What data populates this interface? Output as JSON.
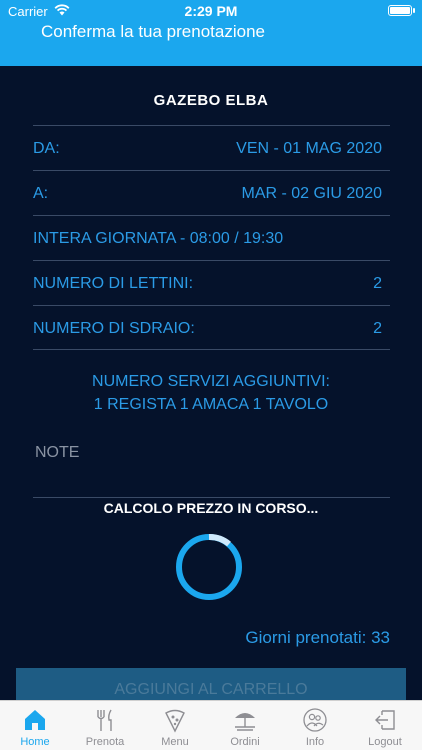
{
  "status_bar": {
    "carrier": "Carrier",
    "time": "2:29 PM"
  },
  "nav": {
    "title": "Conferma la tua prenotazione"
  },
  "booking": {
    "place": "GAZEBO ELBA",
    "from_label": "DA:",
    "from_value": "VEN - 01 MAG 2020",
    "to_label": "A:",
    "to_value": "MAR - 02 GIU 2020",
    "period": "INTERA GIORNATA - 08:00 / 19:30",
    "beds_label": "NUMERO DI LETTINI:",
    "beds_value": "2",
    "chairs_label": "NUMERO DI SDRAIO:",
    "chairs_value": "2",
    "extras_label": "NUMERO SERVIZI AGGIUNTIVI:",
    "extras_value": "1 REGISTA 1 AMACA 1 TAVOLO"
  },
  "note": {
    "placeholder": "NOTE"
  },
  "calc_status": "CALCOLO PREZZO IN CORSO...",
  "days_booked": "Giorni prenotati: 33",
  "cart_button": "AGGIUNGI AL CARRELLO",
  "colors": {
    "accent": "#1ba7ee",
    "background": "#05122b",
    "text_blue": "#2b9be6"
  },
  "tabs": [
    {
      "label": "Home",
      "icon": "home-icon",
      "active": true
    },
    {
      "label": "Prenota",
      "icon": "fork-knife-icon",
      "active": false
    },
    {
      "label": "Menu",
      "icon": "pizza-icon",
      "active": false
    },
    {
      "label": "Ordini",
      "icon": "umbrella-icon",
      "active": false
    },
    {
      "label": "Info",
      "icon": "people-icon",
      "active": false
    },
    {
      "label": "Logout",
      "icon": "logout-icon",
      "active": false
    }
  ]
}
